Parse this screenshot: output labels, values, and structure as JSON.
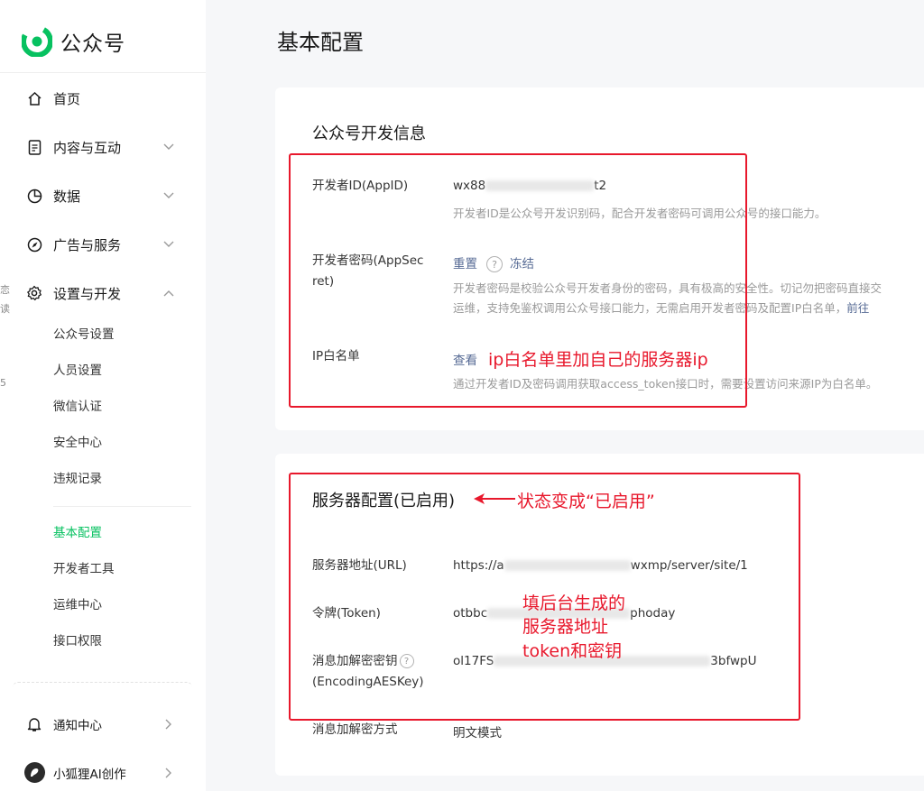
{
  "app": {
    "name": "公众号"
  },
  "sidebar": {
    "nav": [
      {
        "label": "首页",
        "icon": "home-icon"
      },
      {
        "label": "内容与互动",
        "icon": "document-icon"
      },
      {
        "label": "数据",
        "icon": "pie-chart-icon"
      },
      {
        "label": "广告与服务",
        "icon": "compass-icon"
      },
      {
        "label": "设置与开发",
        "icon": "gear-icon"
      }
    ],
    "settings_sub": [
      "公众号设置",
      "人员设置",
      "微信认证",
      "安全中心",
      "违规记录"
    ],
    "dev_sub": [
      "基本配置",
      "开发者工具",
      "运维中心",
      "接口权限"
    ],
    "notify_label": "通知中心",
    "user_label": "小狐狸AI创作",
    "edge_fragments": [
      "恋",
      "读",
      "5"
    ]
  },
  "page": {
    "title": "基本配置"
  },
  "dev_info": {
    "title": "公众号开发信息",
    "appid_label": "开发者ID(AppID)",
    "appid_value_prefix": "wx88",
    "appid_value_suffix": "t2",
    "appid_desc": "开发者ID是公众号开发识别码，配合开发者密码可调用公众号的接口能力。",
    "secret_label_line1": "开发者密码(AppSec",
    "secret_label_line2": "ret)",
    "reset_label": "重置",
    "help_glyph": "?",
    "freeze_label": "冻结",
    "secret_desc_line1": "开发者密码是校验公众号开发者身份的密码，具有极高的安全性。切记勿把密码直接交",
    "secret_desc_line2": "运维，支持免鉴权调用公众号接口能力，无需启用开发者密码及配置IP白名单，",
    "secret_desc_link": "前往",
    "ip_label": "IP白名单",
    "view_label": "查看",
    "ip_desc": "通过开发者ID及密码调用获取access_token接口时，需要设置访问来源IP为白名单。"
  },
  "server": {
    "title": "服务器配置(已启用)",
    "url_label": "服务器地址(URL)",
    "url_value_prefix": "https://a",
    "url_value_suffix": "wxmp/server/site/1",
    "token_label": "令牌(Token)",
    "token_value_prefix": "otbbc",
    "token_value_suffix": "phoday",
    "aes_label_line1": "消息加解密密钥",
    "aes_label_line2": "(EncodingAESKey)",
    "aes_value_prefix": "ol17FS",
    "aes_value_suffix": "3bfwpU",
    "mode_label": "消息加解密方式",
    "mode_value": "明文模式"
  },
  "annotations": {
    "ip_note": "ip白名单里加自己的服务器ip",
    "status_note": "状态变成“已启用”",
    "fill_note_line1": "填后台生成的",
    "fill_note_line2": "服务器地址",
    "fill_note_line3": "token和密钥"
  },
  "colors": {
    "accent": "#07c160",
    "link": "#576b95",
    "annotation": "#e8182c"
  }
}
